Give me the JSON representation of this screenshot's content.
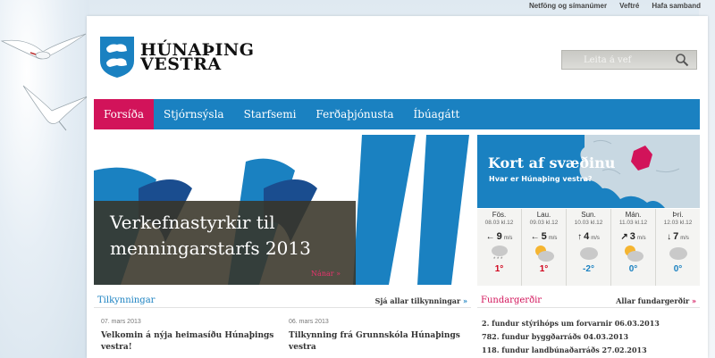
{
  "top_links": [
    "Netföng og símanúmer",
    "Veftré",
    "Hafa samband"
  ],
  "logo": {
    "line1": "HÚNAÞING",
    "line2": "VESTRA"
  },
  "search": {
    "placeholder": "Leita á vef"
  },
  "nav": [
    {
      "label": "Forsíða",
      "active": true
    },
    {
      "label": "Stjórnsýsla"
    },
    {
      "label": "Starfsemi"
    },
    {
      "label": "Ferðaþjónusta"
    },
    {
      "label": "Íbúagátt"
    }
  ],
  "hero": {
    "title": "Verkefnastyrkir til menningarstarfs 2013",
    "more": "Nánar »"
  },
  "map": {
    "title": "Kort af svæðinu",
    "subtitle": "Hvar er Húnaþing vestra?"
  },
  "weather": [
    {
      "day": "Fös.",
      "date": "08.03 kl.12",
      "wind": "9",
      "unit": "m/s",
      "arrow": "←",
      "sky": "snow-icon",
      "temp": "1°",
      "temp_color": "#d0021b"
    },
    {
      "day": "Lau.",
      "date": "09.03 kl.12",
      "wind": "5",
      "unit": "m/s",
      "arrow": "←",
      "sky": "partly-cloudy-icon",
      "temp": "1°",
      "temp_color": "#d0021b"
    },
    {
      "day": "Sun.",
      "date": "10.03 kl.12",
      "wind": "4",
      "unit": "m/s",
      "arrow": "↑",
      "sky": "cloud-icon",
      "temp": "-2°",
      "temp_color": "#1a81c1"
    },
    {
      "day": "Mán.",
      "date": "11.03 kl.12",
      "wind": "3",
      "unit": "m/s",
      "arrow": "↗",
      "sky": "partly-cloudy-icon",
      "temp": "0°",
      "temp_color": "#1a81c1"
    },
    {
      "day": "Þri.",
      "date": "12.03 kl.12",
      "wind": "7",
      "unit": "m/s",
      "arrow": "↓",
      "sky": "cloud-icon",
      "temp": "0°",
      "temp_color": "#1a81c1"
    }
  ],
  "announcements": {
    "heading": "Tilkynningar",
    "all_link": "Sjá allar tilkynningar",
    "items": [
      {
        "date": "07. mars 2013",
        "title": "Velkomin á nýja heimasíðu Húnaþings vestra!"
      },
      {
        "date": "06. mars 2013",
        "title": "Tilkynning frá Grunnskóla Húnaþings vestra"
      }
    ]
  },
  "meetings": {
    "heading": "Fundargerðir",
    "all_link": "Allar fundargerðir",
    "items": [
      "2. fundur stýrihóps um forvarnir 06.03.2013",
      "782. fundur byggðarráðs 04.03.2013",
      "118. fundur landbúnaðarráðs 27.02.2013"
    ]
  },
  "colors": {
    "nav_blue": "#1a81c1",
    "active_pink": "#d2135a",
    "accent_red": "#e8336d"
  }
}
